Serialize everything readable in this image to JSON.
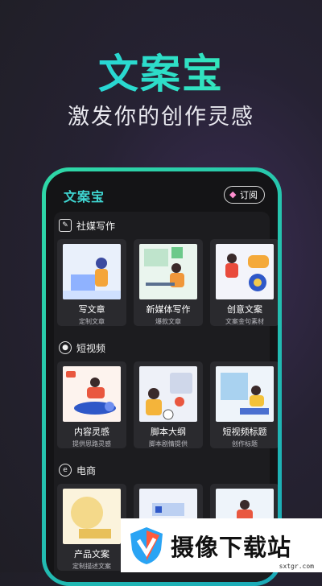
{
  "hero": {
    "title": "文案宝",
    "subtitle": "激发你的创作灵感"
  },
  "app": {
    "logo": "文案宝",
    "subscribe_label": "订阅",
    "accent_color": "#2fd8a6"
  },
  "sections": [
    {
      "title": "社媒写作",
      "icon": "pen-icon",
      "cards": [
        {
          "title": "写文章",
          "subtitle": "定制文章"
        },
        {
          "title": "新媒体写作",
          "subtitle": "爆款文章"
        },
        {
          "title": "创意文案",
          "subtitle": "文案金句素材"
        }
      ]
    },
    {
      "title": "短视频",
      "icon": "video-icon",
      "cards": [
        {
          "title": "内容灵感",
          "subtitle": "提供思路灵感"
        },
        {
          "title": "脚本大纲",
          "subtitle": "脚本剧情提供"
        },
        {
          "title": "短视频标题",
          "subtitle": "创作标题"
        }
      ]
    },
    {
      "title": "电商",
      "icon": "shopping-bag-icon",
      "cards": [
        {
          "title": "产品文案",
          "subtitle": "定制描述文案"
        },
        {
          "title": "",
          "subtitle": ""
        },
        {
          "title": "",
          "subtitle": ""
        }
      ]
    }
  ],
  "watermark": {
    "text": "摄像下载站",
    "url": "sxtgr.com"
  }
}
